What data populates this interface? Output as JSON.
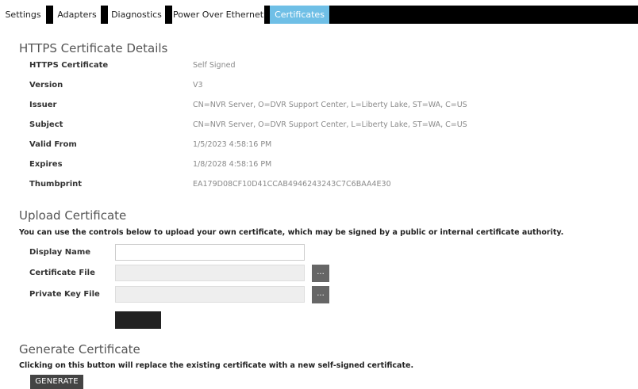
{
  "tabs": [
    {
      "label": "Settings"
    },
    {
      "label": "Adapters"
    },
    {
      "label": "Diagnostics"
    },
    {
      "label": "Power Over Ethernet"
    },
    {
      "label": "Certificates",
      "active": true
    }
  ],
  "details": {
    "title": "HTTPS Certificate Details",
    "rows": [
      {
        "label": "HTTPS Certificate",
        "value": "Self Signed"
      },
      {
        "label": "Version",
        "value": "V3"
      },
      {
        "label": "Issuer",
        "value": "CN=NVR Server, O=DVR Support Center, L=Liberty Lake, ST=WA, C=US"
      },
      {
        "label": "Subject",
        "value": "CN=NVR Server, O=DVR Support Center, L=Liberty Lake, ST=WA, C=US"
      },
      {
        "label": "Valid From",
        "value": "1/5/2023 4:58:16 PM"
      },
      {
        "label": "Expires",
        "value": "1/8/2028 4:58:16 PM"
      },
      {
        "label": "Thumbprint",
        "value": "EA179D08CF10D41CCAB4946243243C7C6BAA4E30"
      }
    ]
  },
  "upload": {
    "title": "Upload Certificate",
    "description": "You can use the controls below to upload your own certificate, which may be signed by a public or internal certificate authority.",
    "display_name_label": "Display Name",
    "display_name_value": "",
    "certificate_file_label": "Certificate File",
    "private_key_file_label": "Private Key File",
    "browse_label": "..."
  },
  "generate": {
    "title": "Generate Certificate",
    "description": "Clicking on this button will replace the existing certificate with a new self-signed certificate.",
    "button_label": "GENERATE"
  },
  "colors": {
    "tabbar": "#000000",
    "active_tab": "#6fbfe6",
    "button_dark": "#444444"
  }
}
